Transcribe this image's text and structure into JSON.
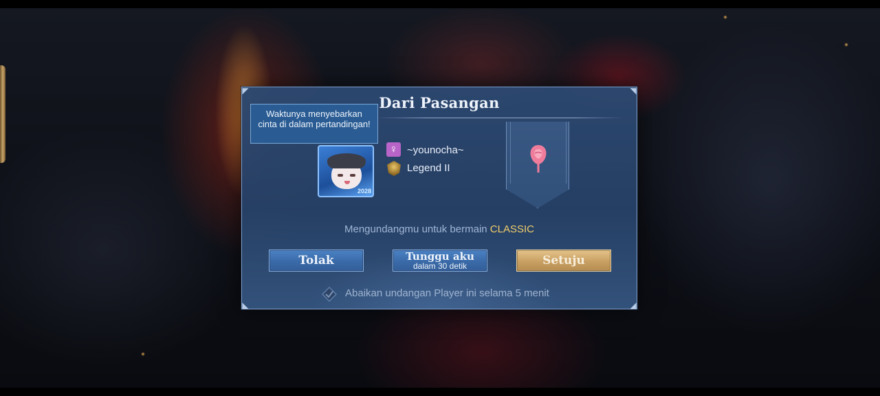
{
  "dialog": {
    "title": "Dari Pasangan",
    "tooltip": "Waktunya menyebarkan cinta di dalam pertandingan!",
    "player": {
      "name": "~younocha~",
      "rank": "Legend II",
      "gender_icon": "female-icon",
      "rank_icon": "legend-rank-icon",
      "avatar_badge": "2028"
    },
    "banner_icon": "rose-icon",
    "invite_text": "Mengundangmu untuk bermain",
    "invite_mode": "CLASSIC",
    "buttons": {
      "reject": "Tolak",
      "wait": "Tunggu aku",
      "wait_sub": "dalam 30 detik",
      "accept": "Setuju"
    },
    "ignore_text": "Abaikan undangan Player ini selama 5 menit"
  },
  "colors": {
    "dialog_bg": "#2c4870",
    "accent_gold": "#f3cf6b",
    "accept_button": "#c9a063",
    "blue_button": "#3a6aa8",
    "gender_female": "#b964c8",
    "rose": "#f07c9c"
  }
}
